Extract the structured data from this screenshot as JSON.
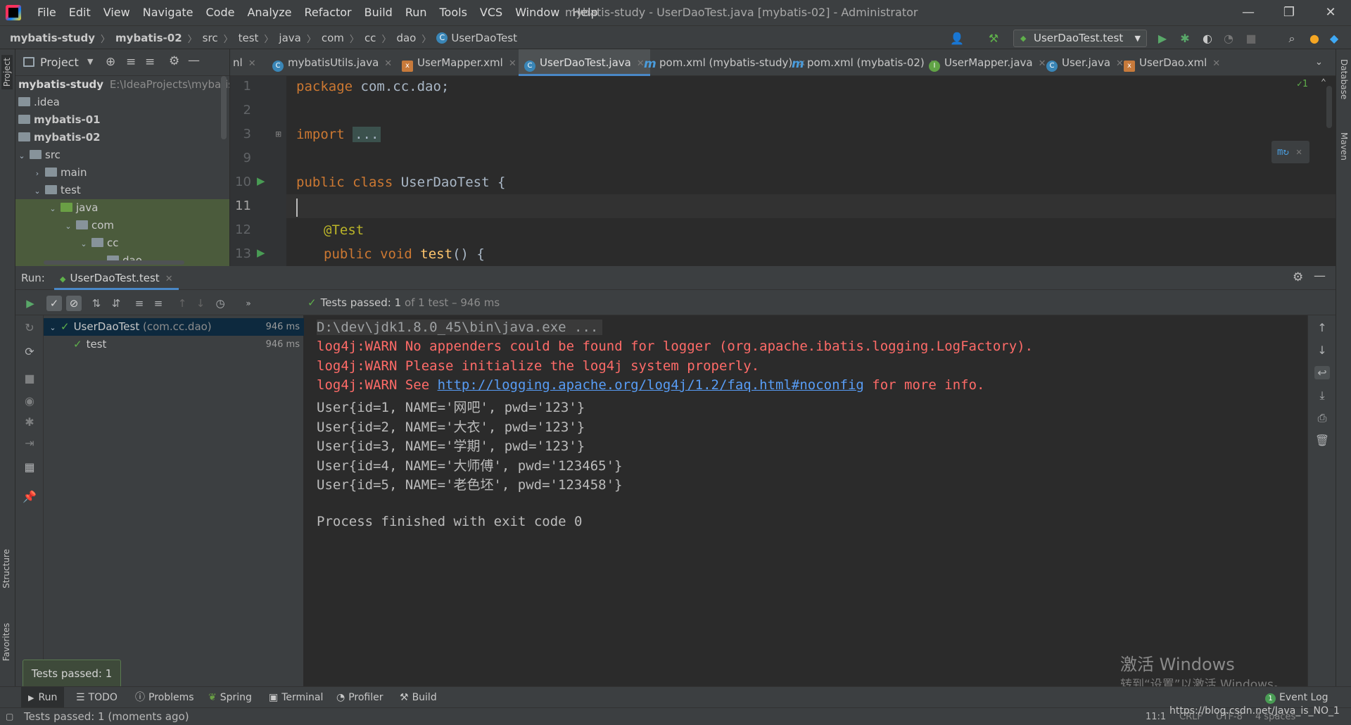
{
  "menubar": {
    "items": [
      "File",
      "Edit",
      "View",
      "Navigate",
      "Code",
      "Analyze",
      "Refactor",
      "Build",
      "Run",
      "Tools",
      "VCS",
      "Window",
      "Help"
    ],
    "window_title": "mybatis-study - UserDaoTest.java [mybatis-02] - Administrator",
    "minimize": "—",
    "restore": "❐",
    "close": "✕"
  },
  "navbar": {
    "breadcrumb": [
      "mybatis-study",
      "mybatis-02",
      "src",
      "test",
      "java",
      "com",
      "cc",
      "dao",
      "UserDaoTest"
    ],
    "run_config": "UserDaoTest.test"
  },
  "project": {
    "title": "Project",
    "tree": [
      {
        "label": "mybatis-study",
        "path": "E:\\IdeaProjects\\mybatis-"
      },
      {
        "label": ".idea"
      },
      {
        "label": "mybatis-01"
      },
      {
        "label": "mybatis-02"
      },
      {
        "label": "src"
      },
      {
        "label": "main"
      },
      {
        "label": "test"
      },
      {
        "label": "java"
      },
      {
        "label": "com"
      },
      {
        "label": "cc"
      },
      {
        "label": "dao"
      }
    ]
  },
  "tabs": [
    {
      "label": "nl",
      "icon": "xml"
    },
    {
      "label": "mybatisUtils.java",
      "icon": "c"
    },
    {
      "label": "UserMapper.xml",
      "icon": "xml"
    },
    {
      "label": "UserDaoTest.java",
      "icon": "c"
    },
    {
      "label": "pom.xml (mybatis-study)",
      "icon": "m"
    },
    {
      "label": "pom.xml (mybatis-02)",
      "icon": "m"
    },
    {
      "label": "UserMapper.java",
      "icon": "i"
    },
    {
      "label": "User.java",
      "icon": "c"
    },
    {
      "label": "UserDao.xml",
      "icon": "xml"
    }
  ],
  "editor": {
    "line_numbers": [
      "1",
      "2",
      "3",
      "9",
      "10",
      "11",
      "12",
      "13"
    ],
    "code": {
      "l1_kw": "package",
      "l1_rest": " com.cc.dao;",
      "l3_kw": "import",
      "l3_fold": "...",
      "l10_kw": "public class",
      "l10_rest": " UserDaoTest {",
      "l12_ann": "@Test",
      "l13_kw": "public void",
      "l13_fn": "test",
      "l13_rest": "() {"
    },
    "inspection_count": "✓1"
  },
  "run": {
    "label": "Run:",
    "tab": "UserDaoTest.test",
    "status_prefix": "Tests passed: ",
    "status_count": "1",
    "status_suffix": " of 1 test – 946 ms",
    "test_tree": [
      {
        "name": "UserDaoTest",
        "pkg": " (com.cc.dao)",
        "time": "946 ms"
      },
      {
        "name": "test",
        "pkg": "",
        "time": "946 ms"
      }
    ],
    "console": {
      "cmd": "D:\\dev\\jdk1.8.0_45\\bin\\java.exe ...",
      "warn1": "log4j:WARN No appenders could be found for logger (org.apache.ibatis.logging.LogFactory).",
      "warn2": "log4j:WARN Please initialize the log4j system properly.",
      "warn3_pre": "log4j:WARN See ",
      "warn3_link": "http://logging.apache.org/log4j/1.2/faq.html#noconfig",
      "warn3_post": " for more info.",
      "users": [
        "User{id=1, NAME='网吧', pwd='123'}",
        "User{id=2, NAME='大衣', pwd='123'}",
        "User{id=3, NAME='学期', pwd='123'}",
        "User{id=4, NAME='大师傅', pwd='123465'}",
        "User{id=5, NAME='老色坯', pwd='123458'}"
      ],
      "exit": "Process finished with exit code 0"
    }
  },
  "watermark": {
    "line1": "激活 Windows",
    "line2": "转到“设置”以激活 Windows。"
  },
  "tooltip": "Tests passed: 1",
  "bottom_tools": [
    "Run",
    "TODO",
    "Problems",
    "Spring",
    "Terminal",
    "Profiler",
    "Build"
  ],
  "event_log": {
    "count": "1",
    "label": "Event Log"
  },
  "side_tabs": {
    "left": [
      "Project",
      "Structure",
      "Favorites"
    ],
    "right": [
      "Database",
      "Maven"
    ]
  },
  "status": {
    "message": "Tests passed: 1 (moments ago)",
    "position": "11:1",
    "line_sep": "CRLF",
    "encoding": "UTF-8",
    "indent": "4 spaces",
    "url": "https://blog.csdn.net/Java_is_NO_1"
  }
}
